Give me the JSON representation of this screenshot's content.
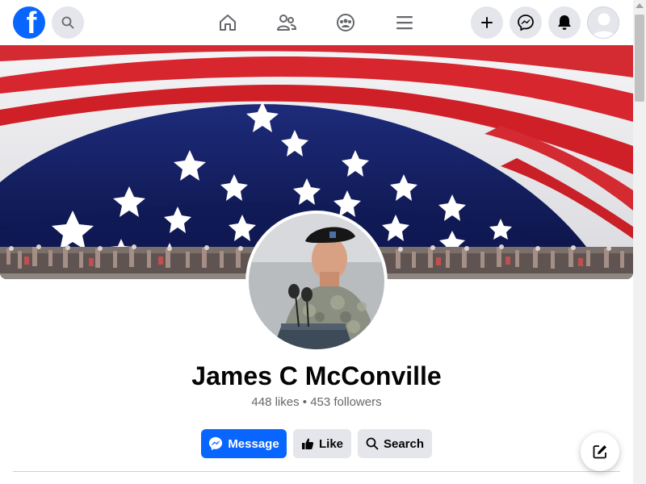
{
  "header": {
    "logo_letter": "f",
    "brand_color": "#0866ff",
    "icons": {
      "search": "search-icon",
      "home": "home-icon",
      "friends": "friends-icon",
      "groups": "groups-icon",
      "menu": "menu-icon",
      "create": "plus-icon",
      "messenger": "messenger-icon",
      "notifications": "bell-icon",
      "account": "avatar"
    }
  },
  "profile": {
    "name": "James C McConville",
    "stats": "448 likes • 453 followers"
  },
  "actions": {
    "message_label": "Message",
    "like_label": "Like",
    "search_label": "Search"
  }
}
